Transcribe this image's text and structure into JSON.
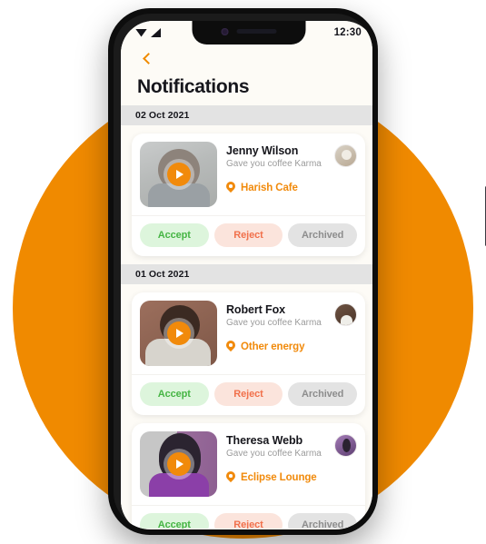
{
  "background": {
    "circle_color": "#F08A00"
  },
  "status_bar": {
    "time": "12:30",
    "wifi_icon": "wifi-icon",
    "signal_icon": "signal-icon"
  },
  "header": {
    "back_icon": "chevron-left-icon",
    "title": "Notifications"
  },
  "colors": {
    "accent": "#F18A0B",
    "accept_text": "#46B544",
    "accept_bg": "#DDF5DC",
    "reject_text": "#F1704B",
    "reject_bg": "#FBE4DC",
    "archived_text": "#8D8D8D",
    "archived_bg": "#E3E3E3",
    "date_band_bg": "#E3E3E3",
    "screen_bg": "#FDFBF6"
  },
  "actions": {
    "accept_label": "Accept",
    "reject_label": "Reject",
    "archived_label": "Archived"
  },
  "groups": [
    {
      "date": "02 Oct 2021",
      "items": [
        {
          "name": "Jenny Wilson",
          "subtitle": "Gave you coffee Karma",
          "place": "Harish Cafe",
          "play_icon": "play-icon",
          "pin_icon": "location-pin-icon",
          "avatar_name": "avatar-jenny-wilson",
          "thumb_name": "thumbnail-jenny-wilson"
        }
      ]
    },
    {
      "date": "01 Oct 2021",
      "items": [
        {
          "name": "Robert Fox",
          "subtitle": "Gave you coffee Karma",
          "place": "Other energy",
          "play_icon": "play-icon",
          "pin_icon": "location-pin-icon",
          "avatar_name": "avatar-robert-fox",
          "thumb_name": "thumbnail-robert-fox"
        },
        {
          "name": "Theresa Webb",
          "subtitle": "Gave you coffee Karma",
          "place": "Eclipse Lounge",
          "play_icon": "play-icon",
          "pin_icon": "location-pin-icon",
          "avatar_name": "avatar-theresa-webb",
          "thumb_name": "thumbnail-theresa-webb"
        }
      ]
    }
  ]
}
